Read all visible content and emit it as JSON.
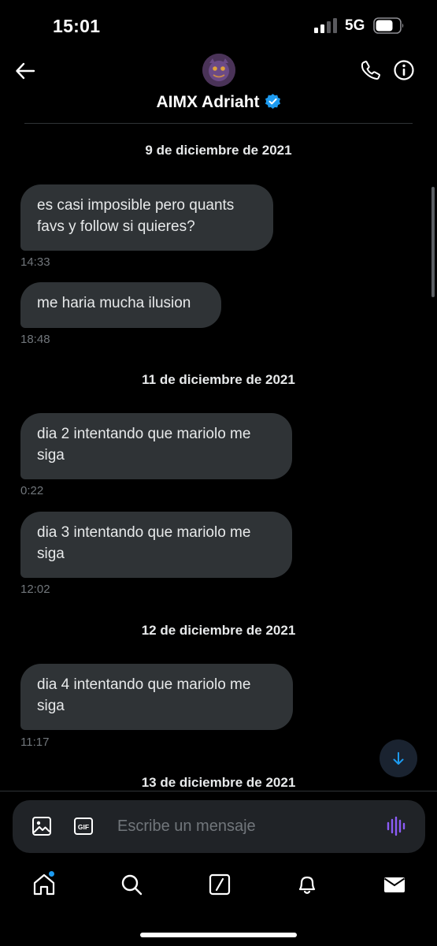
{
  "status_bar": {
    "time": "15:01",
    "network": "5G"
  },
  "header": {
    "contact_name": "AIMX Adriaht",
    "verified": true
  },
  "thread": {
    "dates": [
      "9 de diciembre de 2021",
      "11 de diciembre de 2021",
      "12 de diciembre de 2021",
      "13 de diciembre de 2021"
    ],
    "messages": [
      {
        "text": "es casi imposible pero quants favs y follow si quieres?",
        "time": "14:33"
      },
      {
        "text": "me haria mucha ilusion",
        "time": "18:48"
      },
      {
        "text": "dia 2 intentando que mariolo me siga",
        "time": "0:22"
      },
      {
        "text": "dia 3 intentando que mariolo me siga",
        "time": "12:02"
      },
      {
        "text": "dia 4 intentando que mariolo me siga",
        "time": "11:17"
      }
    ]
  },
  "composer": {
    "placeholder": "Escribe un mensaje",
    "gif_label": "GIF",
    "value": ""
  },
  "tabbar": {
    "items": [
      "home-icon",
      "search-icon",
      "grok-icon",
      "bell-icon",
      "mail-icon"
    ],
    "home_has_badge": true
  },
  "colors": {
    "accent": "#1d9bf0",
    "bubble": "#2f3336",
    "muted": "#71767b",
    "voice": "#8b5cf6"
  }
}
